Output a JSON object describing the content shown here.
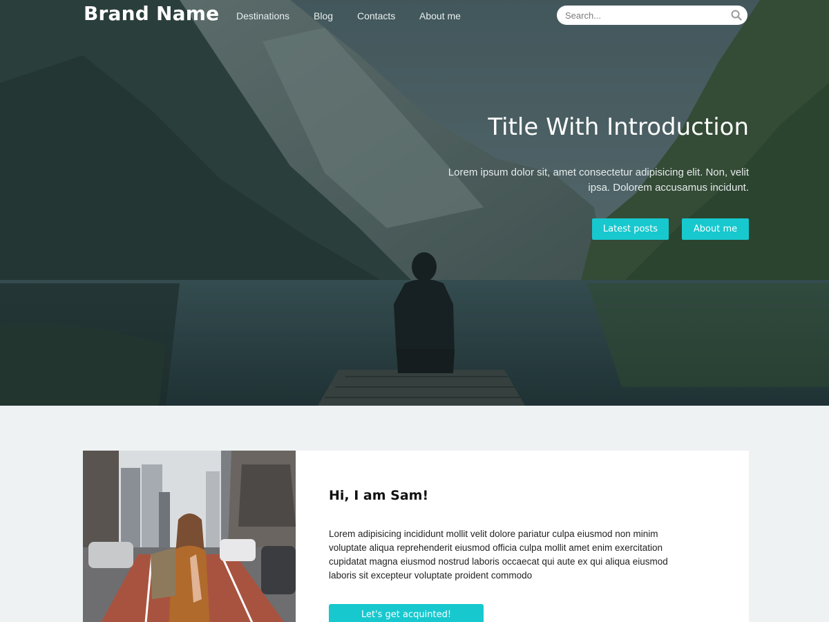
{
  "navbar": {
    "brand": "Brand Name",
    "links": [
      {
        "label": "Destinations"
      },
      {
        "label": "Blog"
      },
      {
        "label": "Contacts"
      },
      {
        "label": "About me"
      }
    ],
    "search": {
      "placeholder": "Search...",
      "icon": "search-icon"
    }
  },
  "hero": {
    "title": "Title With Introduction",
    "text": "Lorem ipsum dolor sit, amet consectetur adipisicing elit. Non, velit ipsa. Dolorem accusamus incidunt.",
    "buttons": {
      "latest": "Latest posts",
      "about": "About me"
    }
  },
  "about": {
    "heading": "Hi, I am Sam!",
    "text": "Lorem adipisicing incididunt mollit velit dolore pariatur culpa eiusmod non minim voluptate aliqua reprehenderit eiusmod officia culpa mollit amet enim exercitation cupidatat magna eiusmod nostrud laboris occaecat qui aute ex qui aliqua eiusmod laboris sit excepteur voluptate proident commodo",
    "button": "Let's get acquinted!"
  },
  "colors": {
    "accent": "#17c8ce",
    "page_background": "#eef2f3",
    "card_background": "#ffffff"
  }
}
